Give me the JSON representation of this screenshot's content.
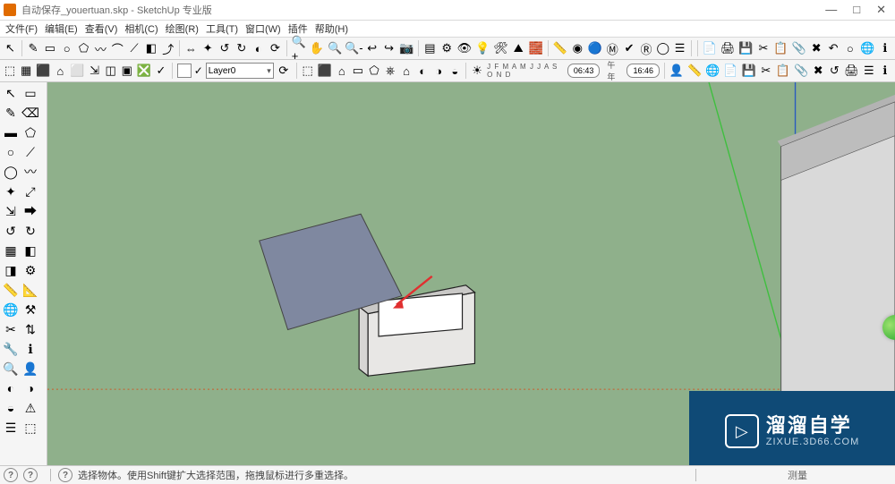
{
  "window": {
    "title": "自动保存_youertuan.skp - SketchUp 专业版",
    "buttons": {
      "min": "—",
      "max": "□",
      "close": "✕"
    }
  },
  "menu": [
    "文件(F)",
    "编辑(E)",
    "查看(V)",
    "相机(C)",
    "绘图(R)",
    "工具(T)",
    "窗口(W)",
    "插件",
    "帮助(H)"
  ],
  "toolbar1": {
    "layer_label": "Layer0",
    "date_strip": "J F M A M J J A S O N D",
    "time1": "06:43",
    "ampm": "午年",
    "time2": "16:46"
  },
  "status": {
    "hint": "选择物体。使用Shift键扩大选择范围，拖拽鼠标进行多重选择。",
    "right": "测量"
  },
  "watermark": {
    "big": "溜溜自学",
    "small": "ZIXUE.3D66.COM"
  },
  "icons": {
    "row1": [
      "↖",
      "✎",
      "▭",
      "○",
      "⬠",
      "〰",
      "⌒",
      "⟋",
      "◧",
      "⤴",
      "⇔",
      "✦",
      "↺",
      "↻",
      "◐",
      "⟳",
      "🔍+",
      "✋",
      "🔍",
      "🔍-",
      "↩",
      "↪",
      "📷",
      "▤",
      "⚙",
      "👁",
      "💡",
      "🛠",
      "⛰",
      "🧱",
      "📏",
      "◉",
      "🔵",
      "Ⓜ",
      "✔",
      "Ⓡ",
      "◯",
      "☰"
    ],
    "row1b": [
      "📄",
      "🖨",
      "💾",
      "✂",
      "📋",
      "📎",
      "✖",
      "↶",
      "○",
      "🌐",
      "ℹ"
    ],
    "row2_left": [
      "⬚",
      "▦",
      "⬛",
      "⌂",
      "⬜",
      "⇲",
      "◫",
      "▣",
      "❎",
      "✓"
    ],
    "row2_mid": [
      "⬚",
      "⬛",
      "⌂",
      "▭",
      "⬠",
      "⎈",
      "⌂",
      "◐",
      "◑",
      "◒"
    ],
    "row2_right": [
      "👤",
      "📏",
      "🌐",
      "📄",
      "💾",
      "✂",
      "📋",
      "📎",
      "✖",
      "↺",
      "🖨",
      "☰",
      "ℹ"
    ],
    "side": [
      "↖",
      "▭",
      "✎",
      "⌫",
      "▬",
      "⬠",
      "○",
      "⟋",
      "◯",
      "〰",
      "✦",
      "⤢",
      "⇲",
      "⮕",
      "↺",
      "↻",
      "▦",
      "◧",
      "◨",
      "⚙",
      "📏",
      "📐",
      "🌐",
      "⚒",
      "✂",
      "⇅",
      "🔧",
      "ℹ",
      "🔍",
      "👤",
      "◐",
      "◑",
      "◒",
      "⚠",
      "☰",
      "⬚"
    ]
  }
}
